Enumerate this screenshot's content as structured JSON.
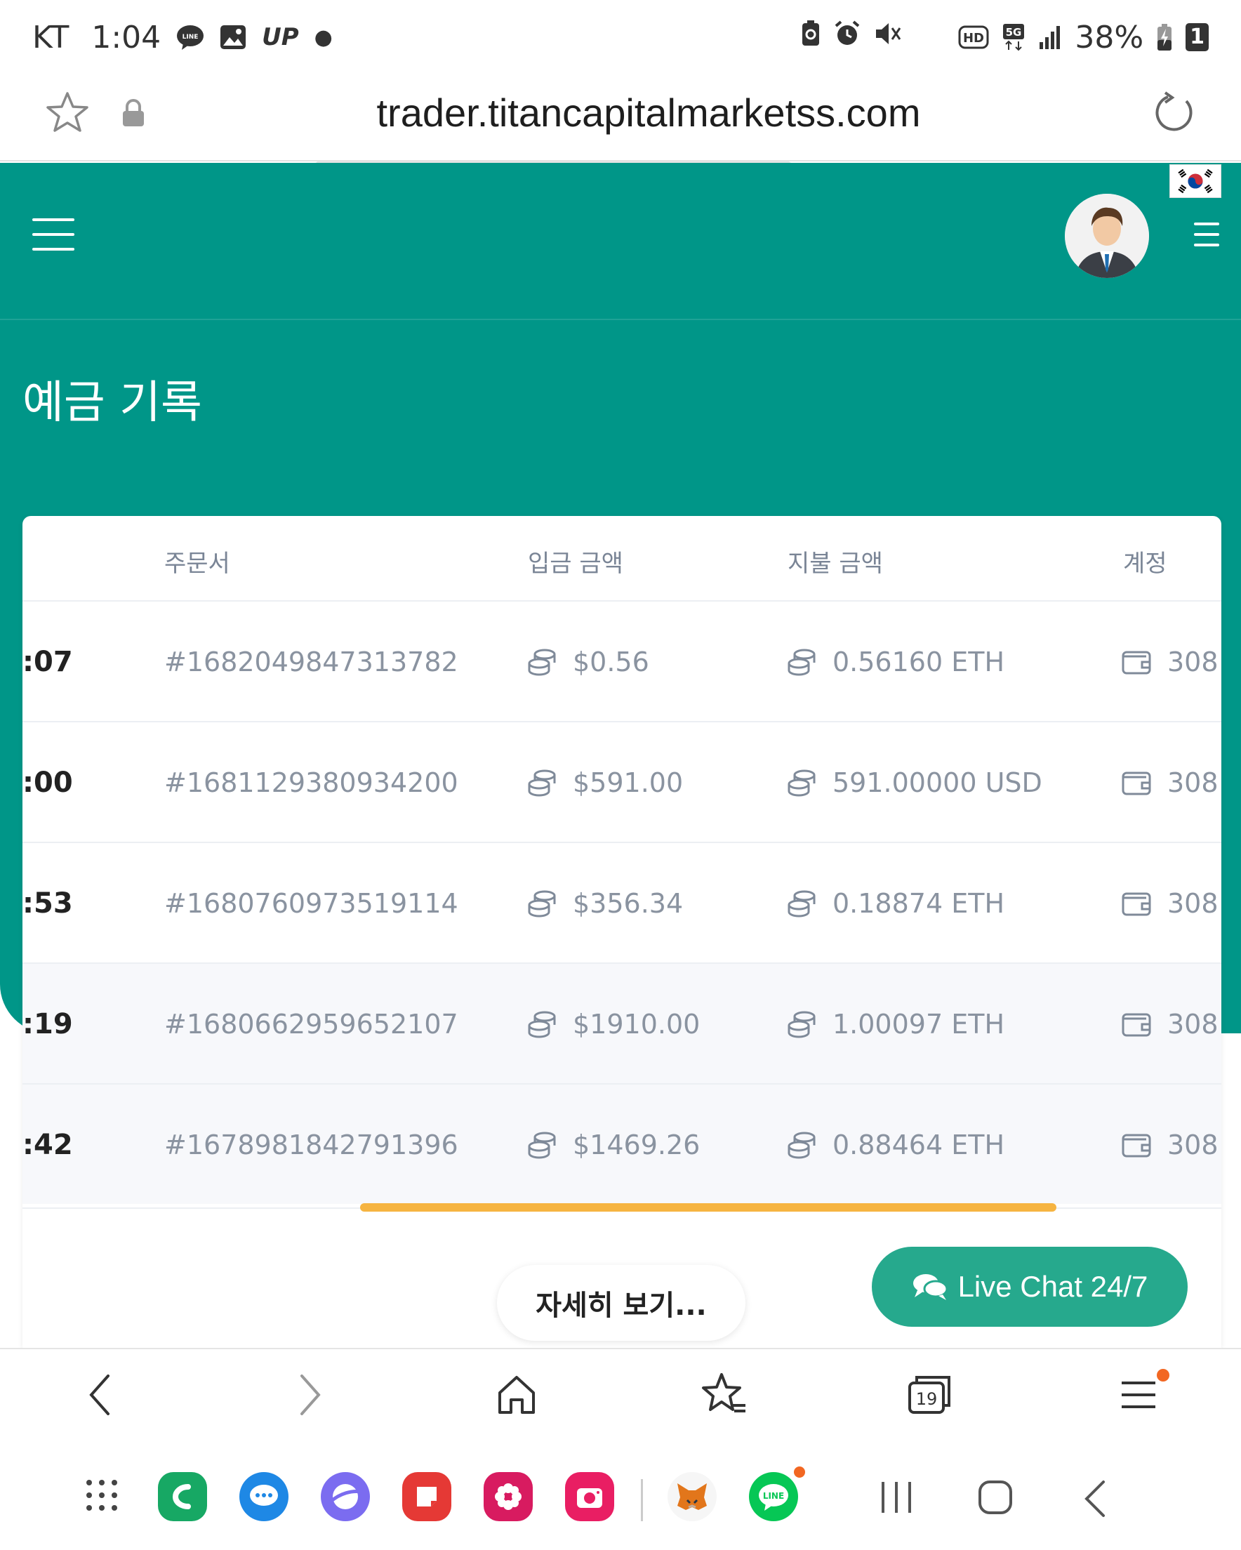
{
  "status_bar": {
    "carrier": "KT",
    "time": "1:04",
    "up_badge": "UP",
    "battery": "38%",
    "sim": "1",
    "network": "5G"
  },
  "url_bar": {
    "url": "trader.titancapitalmarketss.com"
  },
  "header": {
    "page_title": "예금 기록"
  },
  "table": {
    "headers": [
      "주문서",
      "입금 금액",
      "지불 금액",
      "계정"
    ],
    "rows": [
      {
        "time": ":07",
        "order": "#1682049847313782",
        "deposit": "$0.56",
        "paid": "0.56160 ETH",
        "account": "308"
      },
      {
        "time": ":00",
        "order": "#1681129380934200",
        "deposit": "$591.00",
        "paid": "591.00000 USD",
        "account": "308"
      },
      {
        "time": ":53",
        "order": "#1680760973519114",
        "deposit": "$356.34",
        "paid": "0.18874 ETH",
        "account": "308"
      },
      {
        "time": ":19",
        "order": "#1680662959652107",
        "deposit": "$1910.00",
        "paid": "1.00097 ETH",
        "account": "308"
      },
      {
        "time": ":42",
        "order": "#1678981842791396",
        "deposit": "$1469.26",
        "paid": "0.88464 ETH",
        "account": "308"
      }
    ]
  },
  "buttons": {
    "more": "자세히 보기...",
    "live_chat": "Live Chat 24/7"
  },
  "browser_bar": {
    "tabs_count": "19"
  },
  "colors": {
    "teal": "#009688",
    "live_chat": "#26a98d",
    "scroll_accent": "#f6b441"
  }
}
